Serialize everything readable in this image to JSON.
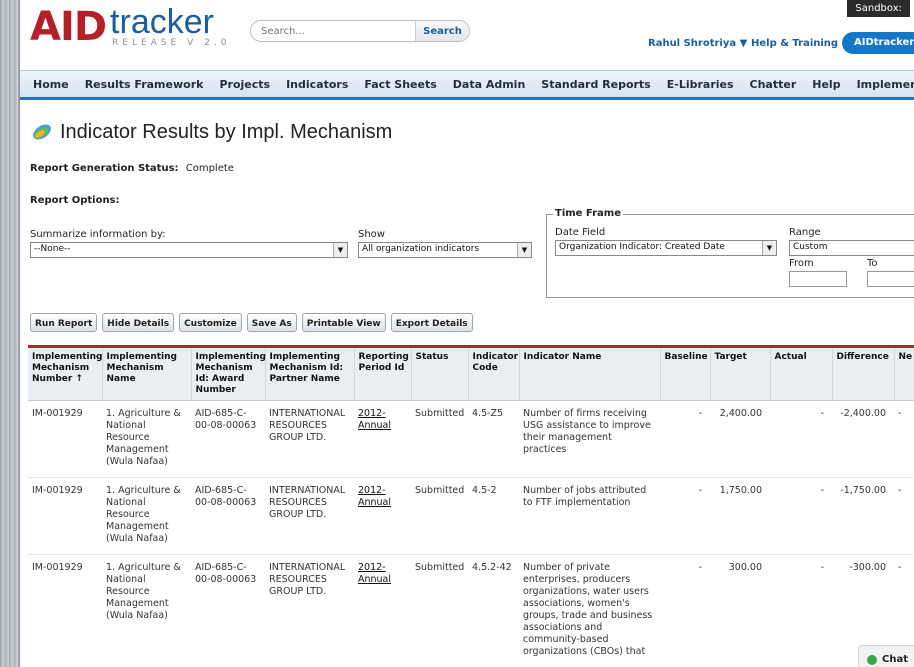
{
  "app": {
    "logo_left": "AID",
    "logo_right": "tracker",
    "release": "RELEASE V 2.0",
    "sandbox": "Sandbox:"
  },
  "search": {
    "placeholder": "Search...",
    "button": "Search"
  },
  "header": {
    "user": "Rahul Shrotriya ▼",
    "help": "Help & Training",
    "app_menu": "AIDtracker"
  },
  "nav": {
    "items": [
      "Home",
      "Results Framework",
      "Projects",
      "Indicators",
      "Fact Sheets",
      "Data Admin",
      "Standard Reports",
      "E-Libraries",
      "Chatter",
      "Help",
      "Implementing Mechanisms"
    ]
  },
  "page": {
    "title": "Indicator Results by Impl. Mechanism",
    "status_label": "Report Generation Status:",
    "status_value": "Complete",
    "options_label": "Report Options:"
  },
  "options": {
    "summarize_label": "Summarize information by:",
    "summarize_value": "--None--",
    "show_label": "Show",
    "show_value": "All organization indicators",
    "timeframe_label": "Time Frame",
    "date_field_label": "Date Field",
    "date_field_value": "Organization Indicator: Created Date",
    "range_label": "Range",
    "range_value": "Custom",
    "from_label": "From",
    "to_label": "To"
  },
  "buttons": {
    "run": "Run Report",
    "hide": "Hide Details",
    "customize": "Customize",
    "save_as": "Save As",
    "printable": "Printable View",
    "export": "Export Details"
  },
  "table": {
    "headers": [
      "Implementing Mechanism Number ↑",
      "Implementing Mechanism Name",
      "Implementing Mechanism Id: Award Number",
      "Implementing Mechanism Id: Partner Name",
      "Reporting Period Id",
      "Status",
      "Indicator Code",
      "Indicator Name",
      "Baseline",
      "Target",
      "Actual",
      "Difference",
      "Ne"
    ],
    "rows": [
      {
        "number": "IM-001929",
        "name": "1. Agriculture & National Resource Management (Wula Nafaa)",
        "award": "AID-685-C-00-08-00063",
        "partner": "INTERNATIONAL RESOURCES GROUP LTD.",
        "period": "2012-Annual",
        "status": "Submitted",
        "code": "4.5-Z5",
        "indicator": "Number of firms receiving USG assistance to improve their management practices",
        "baseline": "-",
        "target": "2,400.00",
        "actual": "-",
        "difference": "-2,400.00",
        "ne": "-"
      },
      {
        "number": "IM-001929",
        "name": "1. Agriculture & National Resource Management (Wula Nafaa)",
        "award": "AID-685-C-00-08-00063",
        "partner": "INTERNATIONAL RESOURCES GROUP LTD.",
        "period": "2012-Annual",
        "status": "Submitted",
        "code": "4.5-2",
        "indicator": "Number of jobs attributed to FTF implementation",
        "baseline": "-",
        "target": "1,750.00",
        "actual": "-",
        "difference": "-1,750.00",
        "ne": "-"
      },
      {
        "number": "IM-001929",
        "name": "1. Agriculture & National Resource Management (Wula Nafaa)",
        "award": "AID-685-C-00-08-00063",
        "partner": "INTERNATIONAL RESOURCES GROUP LTD.",
        "period": "2012-Annual",
        "status": "Submitted",
        "code": "4.5.2-42",
        "indicator": "Number of private enterprises, producers organizations, water users associations, women's groups, trade and business associations and community-based organizations (CBOs) that",
        "baseline": "-",
        "target": "300.00",
        "actual": "-",
        "difference": "-300.00",
        "ne": "-"
      }
    ]
  },
  "chat": {
    "label": "Chat"
  },
  "colors": {
    "brand_red": "#b3202a",
    "brand_blue": "#1a5d9e",
    "nav_accent": "#2873b5",
    "table_accent": "#a9282b"
  }
}
